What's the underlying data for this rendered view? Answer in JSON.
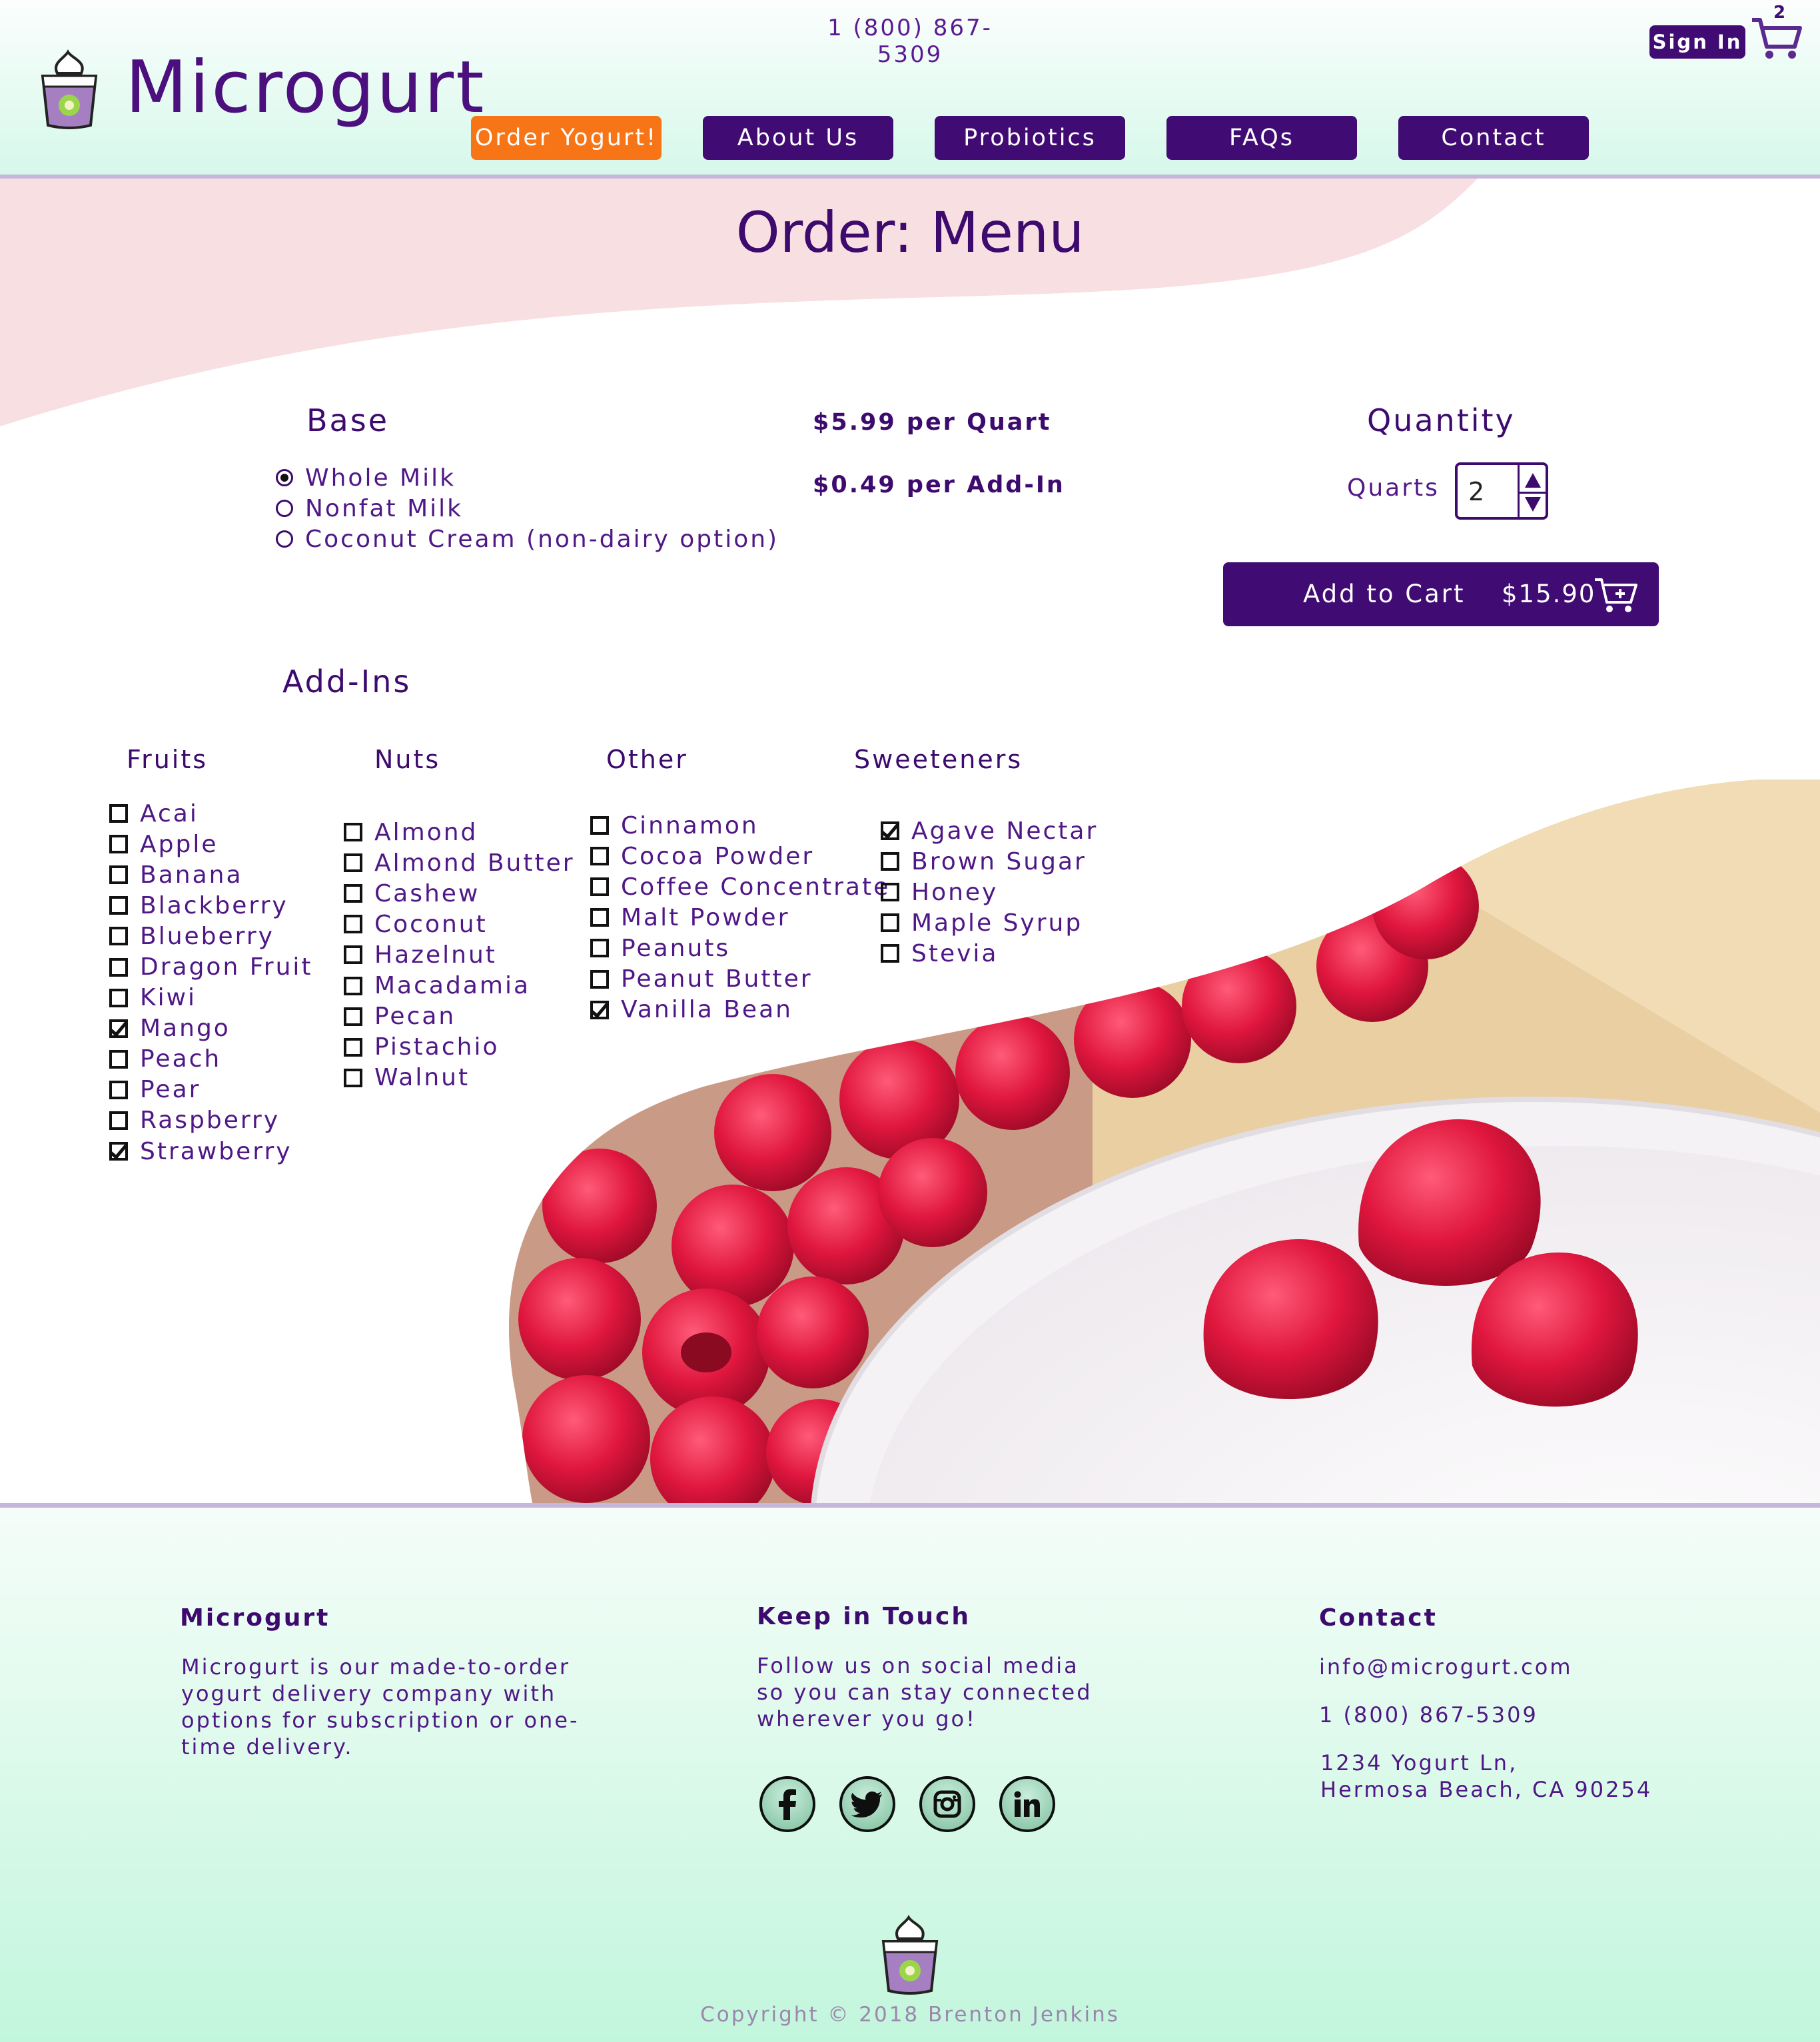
{
  "header": {
    "phone": "1 (800) 867-5309",
    "brand": "Microgurt",
    "nav": [
      "Order Yogurt!",
      "About Us",
      "Probiotics",
      "FAQs",
      "Contact"
    ],
    "signin": "Sign In",
    "cart_count": "2"
  },
  "page_title": "Order: Menu",
  "base": {
    "heading": "Base",
    "options": [
      "Whole Milk",
      "Nonfat Milk",
      "Coconut Cream (non-dairy option)"
    ],
    "selected": "Whole Milk"
  },
  "pricing": {
    "per_quart": "$5.99 per Quart",
    "per_addin": "$0.49 per Add-In"
  },
  "quantity": {
    "heading": "Quantity",
    "label": "Quarts",
    "value": "2"
  },
  "add_to_cart": {
    "label": "Add to Cart",
    "total": "$15.90"
  },
  "addins": {
    "heading": "Add-Ins",
    "categories": [
      {
        "name": "Fruits",
        "items": [
          "Acai",
          "Apple",
          "Banana",
          "Blackberry",
          "Blueberry",
          "Dragon Fruit",
          "Kiwi",
          "Mango",
          "Peach",
          "Pear",
          "Raspberry",
          "Strawberry"
        ],
        "checked": [
          "Mango",
          "Strawberry"
        ]
      },
      {
        "name": "Nuts",
        "items": [
          "Almond",
          "Almond Butter",
          "Cashew",
          "Coconut",
          "Hazelnut",
          "Macadamia",
          "Pecan",
          "Pistachio",
          "Walnut"
        ],
        "checked": []
      },
      {
        "name": "Other",
        "items": [
          "Cinnamon",
          "Cocoa Powder",
          "Coffee Concentrate",
          "Malt Powder",
          "Peanuts",
          "Peanut Butter",
          "Vanilla Bean"
        ],
        "checked": [
          "Vanilla Bean"
        ]
      },
      {
        "name": "Sweeteners",
        "items": [
          "Agave Nectar",
          "Brown Sugar",
          "Honey",
          "Maple Syrup",
          "Stevia"
        ],
        "checked": [
          "Agave Nectar"
        ]
      }
    ]
  },
  "footer": {
    "about": {
      "title": "Microgurt",
      "text": "Microgurt is our made-to-order yogurt delivery company with options for subscription or one-time delivery."
    },
    "social": {
      "title": "Keep in Touch",
      "text": "Follow us on social media so you can stay connected wherever you go!",
      "icons": [
        "facebook-icon",
        "twitter-icon",
        "instagram-icon",
        "linkedin-icon"
      ]
    },
    "contact": {
      "title": "Contact",
      "email": "info@microgurt.com",
      "phone": "1 (800) 867-5309",
      "address_line1": "1234 Yogurt Ln,",
      "address_line2": "Hermosa Beach, CA 90254"
    },
    "copyright": "Copyright © 2018 Brenton Jenkins"
  },
  "colors": {
    "brand_purple": "#400b72",
    "accent_orange": "#f77517",
    "mint": "#c2f6dc",
    "pink": "#f8dfe2"
  }
}
